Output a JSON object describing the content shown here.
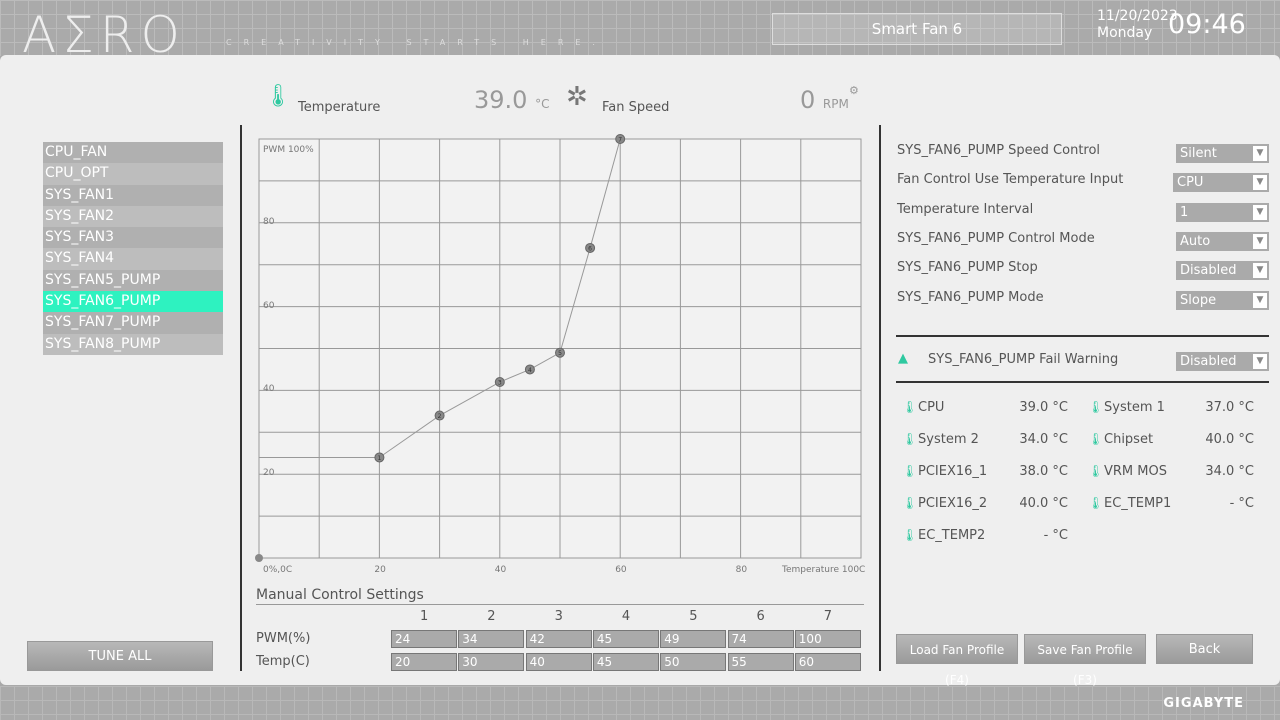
{
  "header": {
    "logo": "AΣRO",
    "tagline": "CREATIVITY STARTS HERE.",
    "title": "Smart Fan 6",
    "date": "11/20/2023",
    "day": "Monday",
    "time": "09:46"
  },
  "status": {
    "temperature_label": "Temperature",
    "temperature_value": "39.0",
    "temperature_unit": "°C",
    "fan_label": "Fan Speed",
    "fan_value": "0",
    "fan_unit": "RPM"
  },
  "fans": {
    "items": [
      "CPU_FAN",
      "CPU_OPT",
      "SYS_FAN1",
      "SYS_FAN2",
      "SYS_FAN3",
      "SYS_FAN4",
      "SYS_FAN5_PUMP",
      "SYS_FAN6_PUMP",
      "SYS_FAN7_PUMP",
      "SYS_FAN8_PUMP"
    ],
    "selected": "SYS_FAN6_PUMP"
  },
  "tune_all": "TUNE ALL",
  "chart_data": {
    "type": "line",
    "ylabel": "PWM 100%",
    "xlabel": "Temperature 100C",
    "origin_label": "0%,0C",
    "xlim": [
      0,
      100
    ],
    "ylim": [
      0,
      100
    ],
    "x_ticks": [
      "20",
      "40",
      "60",
      "80"
    ],
    "y_ticks": [
      "80",
      "60",
      "40",
      "20"
    ],
    "grid": true,
    "points": [
      {
        "x": 20,
        "y": 24
      },
      {
        "x": 30,
        "y": 34
      },
      {
        "x": 40,
        "y": 42
      },
      {
        "x": 45,
        "y": 45
      },
      {
        "x": 50,
        "y": 49
      },
      {
        "x": 55,
        "y": 74
      },
      {
        "x": 60,
        "y": 100
      }
    ],
    "colors": {
      "line": "#999999",
      "point": "#888888"
    }
  },
  "manual": {
    "title": "Manual Control Settings",
    "columns": [
      "1",
      "2",
      "3",
      "4",
      "5",
      "6",
      "7"
    ],
    "pwm_label": "PWM(%)",
    "temp_label": "Temp(C)",
    "pwm": [
      "24",
      "34",
      "42",
      "45",
      "49",
      "74",
      "100"
    ],
    "temp": [
      "20",
      "30",
      "40",
      "45",
      "50",
      "55",
      "60"
    ]
  },
  "settings": [
    {
      "label": "SYS_FAN6_PUMP Speed Control",
      "value": "Silent"
    },
    {
      "label": "Fan Control Use Temperature Input",
      "value": "CPU"
    },
    {
      "label": "Temperature Interval",
      "value": "1"
    },
    {
      "label": "SYS_FAN6_PUMP Control Mode",
      "value": "Auto"
    },
    {
      "label": "SYS_FAN6_PUMP Stop",
      "value": "Disabled"
    },
    {
      "label": "SYS_FAN6_PUMP Mode",
      "value": "Slope"
    }
  ],
  "fail_warning": {
    "label": "SYS_FAN6_PUMP Fail Warning",
    "value": "Disabled"
  },
  "sensors": [
    {
      "name": "CPU",
      "value": "39.0 °C"
    },
    {
      "name": "System 1",
      "value": "37.0 °C"
    },
    {
      "name": "System 2",
      "value": "34.0 °C"
    },
    {
      "name": "Chipset",
      "value": "40.0 °C"
    },
    {
      "name": "PCIEX16_1",
      "value": "38.0 °C"
    },
    {
      "name": "VRM MOS",
      "value": "34.0 °C"
    },
    {
      "name": "PCIEX16_2",
      "value": "40.0 °C"
    },
    {
      "name": "EC_TEMP1",
      "value": "- °C"
    },
    {
      "name": "EC_TEMP2",
      "value": "- °C"
    }
  ],
  "buttons": {
    "load": "Load Fan Profile (F4)",
    "save": "Save Fan Profile (F3)",
    "back": "Back"
  },
  "brand": "GIGABYTE",
  "accent": "#2ef2c0"
}
